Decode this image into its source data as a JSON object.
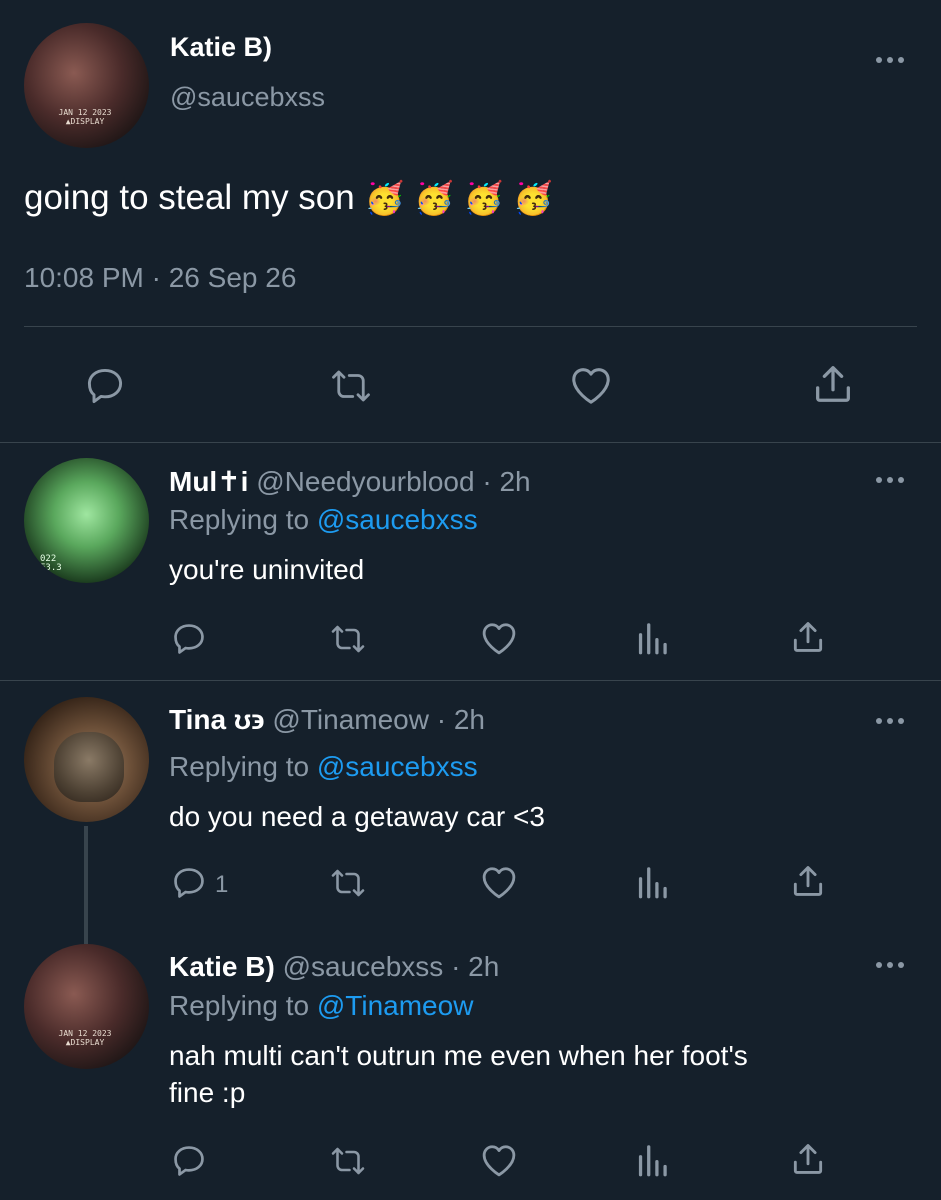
{
  "main_tweet": {
    "display_name": "Katie B)",
    "handle": "@saucebxss",
    "avatar_caption": [
      "JAN 12 2023",
      "▲DISPLAY"
    ],
    "text": "going to steal my son",
    "emojis": [
      "🥳",
      "🥳",
      "🥳",
      "🥳"
    ],
    "timestamp": "10:08 PM · 26 Sep 26"
  },
  "replies": [
    {
      "display_name": "Mul✝i",
      "handle": "@Needyourblood",
      "time": "· 2h",
      "replying_prefix": "Replying to",
      "replying_to": "@saucebxss",
      "text": "you're uninvited",
      "reply_count": "",
      "avatar_caption": [
        "022",
        "E3.3"
      ]
    },
    {
      "display_name": "Tina ʊ϶",
      "handle": "@Tinameow",
      "time": "· 2h",
      "replying_prefix": "Replying to",
      "replying_to": "@saucebxss",
      "text": "do you need a getaway car <3",
      "reply_count": "1"
    },
    {
      "display_name": "Katie B)",
      "handle": "@saucebxss",
      "time": "· 2h",
      "replying_prefix": "Replying to",
      "replying_to": "@Tinameow",
      "text_lines": [
        "nah multi can't outrun me even when her foot's",
        "fine :p"
      ],
      "reply_count": "",
      "avatar_caption": [
        "JAN 12 2023",
        "▲DISPLAY"
      ]
    }
  ],
  "icons": [
    "reply-icon",
    "retweet-icon",
    "like-icon",
    "analytics-icon",
    "share-icon",
    "more-icon"
  ],
  "colors": {
    "background": "#15202b",
    "muted": "#8b98a5",
    "link": "#1d9bf0",
    "divider": "#38444d"
  }
}
